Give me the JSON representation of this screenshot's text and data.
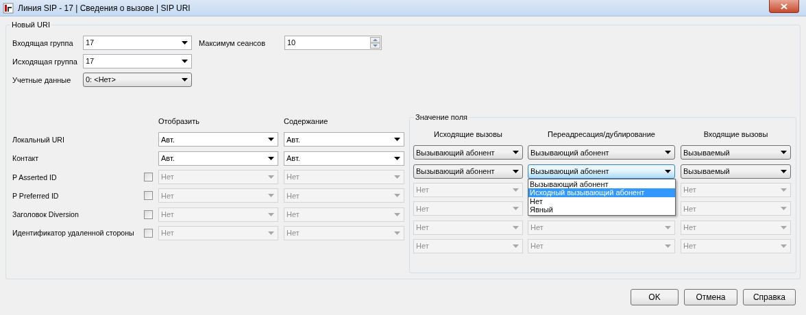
{
  "window": {
    "title": "Линия SIP - 17 | Сведения о вызове | SIP URI"
  },
  "new_uri": {
    "title": "Новый URI",
    "fields": [
      {
        "label": "Входящая группа",
        "value": "17",
        "kind": "edit"
      },
      {
        "label": "Максимум сеансов",
        "value": "10",
        "kind": "spin"
      },
      {
        "label": "Исходящая группа",
        "value": "17",
        "kind": "edit"
      },
      {
        "label": "Учетные данные",
        "value": "0: <Нет>",
        "kind": "list"
      }
    ]
  },
  "columns": [
    "Отобразить",
    "Содержание"
  ],
  "field_value": {
    "title": "Значение поля",
    "columns": [
      "Исходящие вызовы",
      "Переадресация/дублирование",
      "Входящие вызовы"
    ]
  },
  "rows": [
    {
      "label": "Локальный URI",
      "kind": "plain",
      "display": {
        "value": "Авт.",
        "disabled": false
      },
      "content": {
        "value": "Авт.",
        "disabled": false
      },
      "outgoing": {
        "value": "Вызывающий абонент",
        "disabled": false
      },
      "redirect": {
        "value": "Вызывающий абонент",
        "disabled": false,
        "open": false
      },
      "incoming": {
        "value": "Вызываемый",
        "disabled": false
      }
    },
    {
      "label": "Контакт",
      "kind": "plain",
      "display": {
        "value": "Авт.",
        "disabled": false
      },
      "content": {
        "value": "Авт.",
        "disabled": false
      },
      "outgoing": {
        "value": "Вызывающий абонент",
        "disabled": false
      },
      "redirect": {
        "value": "Вызывающий абонент",
        "disabled": false,
        "open": true
      },
      "incoming": {
        "value": "Вызываемый",
        "disabled": false
      }
    },
    {
      "label": "P Asserted ID",
      "kind": "optional",
      "checked": false,
      "display": {
        "value": "Нет",
        "disabled": true
      },
      "content": {
        "value": "Нет",
        "disabled": true
      },
      "outgoing": {
        "value": "Нет",
        "disabled": true
      },
      "incoming": {
        "value": "Нет",
        "disabled": true
      }
    },
    {
      "label": "P Preferred  ID",
      "kind": "optional",
      "checked": false,
      "display": {
        "value": "Нет",
        "disabled": true
      },
      "content": {
        "value": "Нет",
        "disabled": true
      },
      "outgoing": {
        "value": "Нет",
        "disabled": true
      },
      "incoming": {
        "value": "Нет",
        "disabled": true
      }
    },
    {
      "label": "Заголовок Diversion",
      "kind": "optional",
      "checked": false,
      "display": {
        "value": "Нет",
        "disabled": true
      },
      "content": {
        "value": "Нет",
        "disabled": true
      },
      "outgoing": {
        "value": "Нет",
        "disabled": true
      },
      "redirect": {
        "value": "Нет",
        "disabled": true,
        "open": false
      },
      "incoming": {
        "value": "Нет",
        "disabled": true
      }
    },
    {
      "label": "Идентификатор удаленной стороны",
      "kind": "optional",
      "checked": false,
      "display": {
        "value": "Нет",
        "disabled": true
      },
      "content": {
        "value": "Нет",
        "disabled": true
      },
      "outgoing": {
        "value": "Нет",
        "disabled": true
      },
      "redirect": {
        "value": "Нет",
        "disabled": true,
        "open": false
      },
      "incoming": {
        "value": "Нет",
        "disabled": true
      }
    }
  ],
  "dropdown_options": [
    {
      "label": "Вызывающий абонент",
      "selected": false
    },
    {
      "label": "Исходный вызывающий абонент",
      "selected": true
    },
    {
      "label": "Нет",
      "selected": false
    },
    {
      "label": "Явный",
      "selected": false
    }
  ],
  "buttons": [
    "OK",
    "Отмена",
    "Справка"
  ]
}
